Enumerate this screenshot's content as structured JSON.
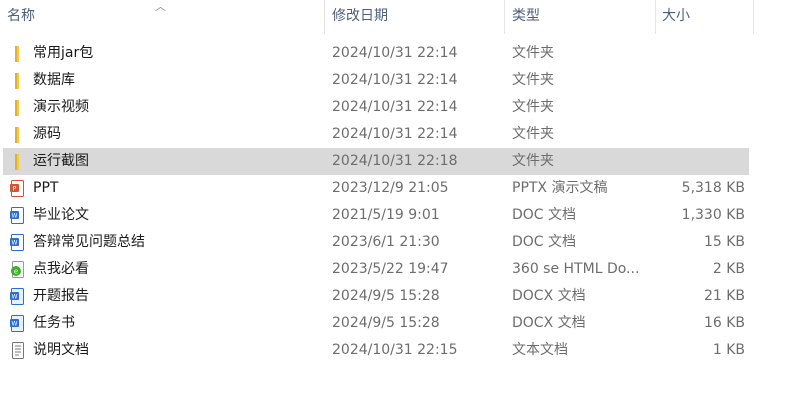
{
  "columns": {
    "name": "名称",
    "date": "修改日期",
    "type": "类型",
    "size": "大小"
  },
  "files": [
    {
      "name": "常用jar包",
      "date": "2024/10/31 22:14",
      "type": "文件夹",
      "size": "",
      "icon": "folder-icon"
    },
    {
      "name": "数据库",
      "date": "2024/10/31 22:14",
      "type": "文件夹",
      "size": "",
      "icon": "folder-icon"
    },
    {
      "name": "演示视频",
      "date": "2024/10/31 22:14",
      "type": "文件夹",
      "size": "",
      "icon": "folder-icon"
    },
    {
      "name": "源码",
      "date": "2024/10/31 22:14",
      "type": "文件夹",
      "size": "",
      "icon": "folder-icon"
    },
    {
      "name": "运行截图",
      "date": "2024/10/31 22:18",
      "type": "文件夹",
      "size": "",
      "icon": "folder-icon",
      "selected": true
    },
    {
      "name": "PPT",
      "date": "2023/12/9 21:05",
      "type": "PPTX 演示文稿",
      "size": "5,318 KB",
      "icon": "pptx-icon"
    },
    {
      "name": "毕业论文",
      "date": "2021/5/19 9:01",
      "type": "DOC 文档",
      "size": "1,330 KB",
      "icon": "doc-icon"
    },
    {
      "name": "答辩常见问题总结",
      "date": "2023/6/1 21:30",
      "type": "DOC 文档",
      "size": "15 KB",
      "icon": "doc-icon"
    },
    {
      "name": "点我必看",
      "date": "2023/5/22 19:47",
      "type": "360 se HTML Do...",
      "size": "2 KB",
      "icon": "html-icon"
    },
    {
      "name": "开题报告",
      "date": "2024/9/5 15:28",
      "type": "DOCX 文档",
      "size": "21 KB",
      "icon": "docx-icon"
    },
    {
      "name": "任务书",
      "date": "2024/9/5 15:28",
      "type": "DOCX 文档",
      "size": "16 KB",
      "icon": "docx-icon"
    },
    {
      "name": "说明文档",
      "date": "2024/10/31 22:15",
      "type": "文本文档",
      "size": "1 KB",
      "icon": "text-icon"
    }
  ],
  "colors": {
    "folder": "#f2c94c",
    "selected_row": "#d9d9d9",
    "header_text": "#4c607a",
    "pptx": "#d35230",
    "doc": "#2b6fd6",
    "html": "#3fae2a"
  }
}
